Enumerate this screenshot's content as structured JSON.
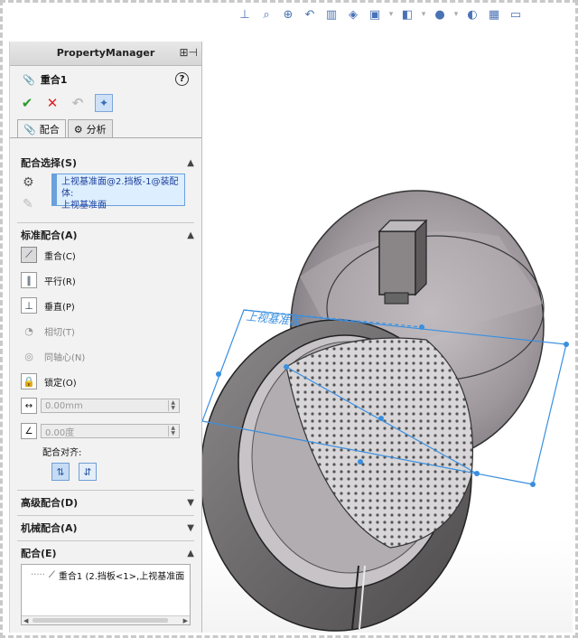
{
  "property_manager": {
    "title": "PropertyManager",
    "feature_name": "重合1",
    "help_label": "?"
  },
  "tabs": [
    {
      "label": "配合"
    },
    {
      "label": "分析"
    }
  ],
  "sections": {
    "mate_selections": {
      "title": "配合选择(S)",
      "entries": [
        "上视基准面@2.挡板-1@装配体:",
        "上视基准面"
      ]
    },
    "standard_mates": {
      "title": "标准配合(A)",
      "items": [
        {
          "label": "重合(C)",
          "icon": "coincident-icon",
          "selected": true
        },
        {
          "label": "平行(R)",
          "icon": "parallel-icon"
        },
        {
          "label": "垂直(P)",
          "icon": "perpendicular-icon"
        },
        {
          "label": "相切(T)",
          "icon": "tangent-icon",
          "disabled": true
        },
        {
          "label": "同轴心(N)",
          "icon": "concentric-icon",
          "disabled": true
        },
        {
          "label": "锁定(O)",
          "icon": "lock-icon"
        }
      ],
      "distance_value": "0.00mm",
      "angle_value": "0.00度",
      "alignment_label": "配合对齐:"
    },
    "advanced_mates": {
      "title": "高级配合(D)"
    },
    "mechanical_mates": {
      "title": "机械配合(A)"
    },
    "mates": {
      "title": "配合(E)",
      "entry": "重合1 (2.挡板<1>,上视基准面"
    }
  },
  "viewport": {
    "plane_label": "上视基准面"
  },
  "colors": {
    "accent": "#3a8fe0",
    "selection_bg": "#ddeeff",
    "ok_green": "#2a9a2a",
    "cancel_red": "#dd2222"
  }
}
